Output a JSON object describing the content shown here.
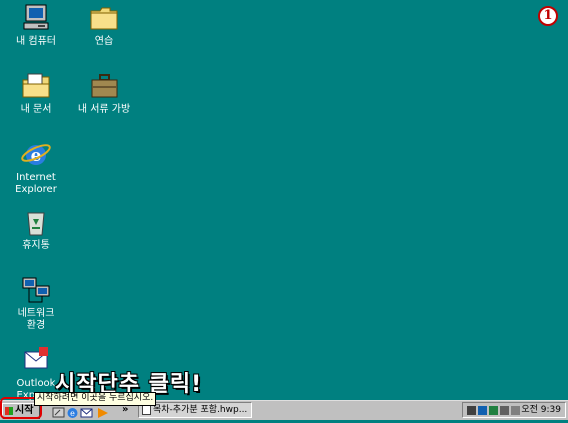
{
  "desktop": {
    "icons": [
      {
        "label": "내 컴퓨터",
        "icon": "computer-icon"
      },
      {
        "label": "연습",
        "icon": "folder-icon"
      },
      {
        "label": "내 문서",
        "icon": "documents-folder-icon"
      },
      {
        "label": "내 서류 가방",
        "icon": "briefcase-icon"
      },
      {
        "label": "Internet\nExplorer",
        "icon": "internet-explorer-icon"
      },
      {
        "label": "휴지통",
        "icon": "recycle-bin-icon"
      },
      {
        "label": "네트워크\n환경",
        "icon": "network-icon"
      },
      {
        "label": "Outlook\nExpress",
        "icon": "outlook-express-icon"
      }
    ],
    "step_badge": "1",
    "instruction": "시작단추 클릭!"
  },
  "taskbar": {
    "start_label": "시작",
    "tooltip": "시작하려면 이곳을 누르십시오.",
    "quicklaunch_chevron": "»",
    "task_item": "목차-추가분 포함.hwp...",
    "clock": "오전 9:39"
  },
  "colors": {
    "desktop": "#008080",
    "taskbar": "#c0c0c0",
    "highlight": "#e00000"
  }
}
